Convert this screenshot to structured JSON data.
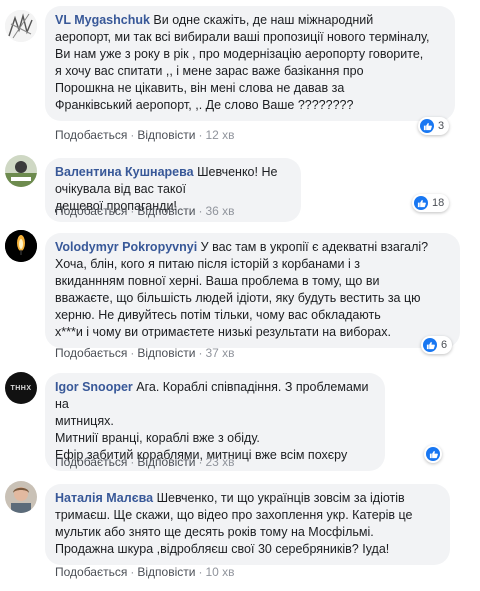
{
  "comments": [
    {
      "author": "VL Mygashchuk",
      "text": "Ви одне скажіть, де наш міжнародний\nаеропорт, ми так всі вибирали ваші пропозиції нового терміналу,\nВи нам уже з року в рік , про модернізацію аеропорту говорите,\nя хочу вас спитати ,, і мене зарас важе базікання про\nПорошкна не цікавить, він мені слова не давав за\nФранківський аеропорт, ,. Де слово Ваше ????????",
      "like": "Подобається",
      "reply": "Відповісти",
      "time": "12 хв",
      "reactions": "3"
    },
    {
      "author": "Валентина Кушнарева",
      "text": "Шевченко! Не очікувала від вас такої\nдешевої пропаганди!",
      "like": "Подобається",
      "reply": "Відповісти",
      "time": "36 хв",
      "reactions": "18"
    },
    {
      "author": "Volodymyr Pokropyvnyi",
      "text": "У вас там в укропії є адекватні взагалі?\nХоча, блін, кого я питаю після історій з корбанами і з\nвкиданнням повної херні. Ваша проблема в тому, що ви\nвважаєте, що більшість людей ідіоти, яку будуть вестить за цю\nхерню. Не дивуйтесь потім тільки, чому вас обкладають\nх***и і чому ви отримаєтете низькі результати на виборах.",
      "like": "Подобається",
      "reply": "Відповісти",
      "time": "37 хв",
      "reactions": "6"
    },
    {
      "author": "Igor Snooper",
      "text": "Ага. Кораблі співпадіння. З проблемами на\nмитницях.\nМитниії вранці, кораблі вже з обіду.\nЕфір забитий кораблями, митниці вже всім похєру",
      "like": "Подобається",
      "reply": "Відповісти",
      "time": "23 хв",
      "reactions": "",
      "avatar_text": "THHX"
    },
    {
      "author": "Наталія Малєва",
      "text": "Шевченко, ти що українців зовсім за ідіотів\nтримаєш. Ще скажи, що відео про захоплення укр. Катерів це\nмультик або знято ще десять років тому на Мосфільмі.\nПродажна шкура ,відробляєш свої 30 серебряників? Іуда!",
      "like": "Подобається",
      "reply": "Відповісти",
      "time": "10 хв",
      "reactions": ""
    }
  ],
  "colors": {
    "author": "#385898",
    "bubble": "#f2f3f5",
    "like_blue": "#1877f2",
    "meta": "#90949c"
  }
}
